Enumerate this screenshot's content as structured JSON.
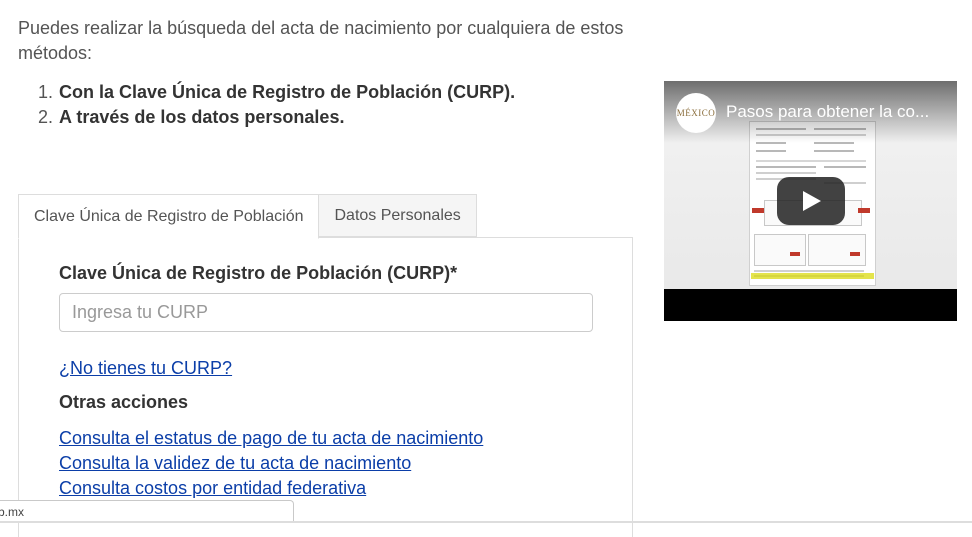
{
  "intro": {
    "text": "Puedes realizar la búsqueda del acta de nacimiento por cualquiera de estos métodos:"
  },
  "methods": [
    {
      "num": "1.",
      "text": "Con la Clave Única de Registro de Población (CURP)."
    },
    {
      "num": "2.",
      "text": "A través de los datos personales."
    }
  ],
  "tabs": [
    {
      "label": "Clave Única de Registro de Población",
      "active": true
    },
    {
      "label": "Datos Personales",
      "active": false
    }
  ],
  "form": {
    "curp_label": "Clave Única de Registro de Población (CURP)*",
    "curp_placeholder": "Ingresa tu CURP",
    "curp_value": "",
    "no_curp_link": "¿No tienes tu CURP?"
  },
  "other_actions": {
    "title": "Otras acciones",
    "links": [
      "Consulta el estatus de pago de tu acta de nacimiento",
      "Consulta la validez de tu acta de nacimiento",
      "Consulta costos por entidad federativa"
    ]
  },
  "video": {
    "channel_logo_text": "MÉXICO",
    "title": "Pasos para obtener la co...",
    "play_icon": "play-icon"
  },
  "status_bar": {
    "url": "b.mx"
  },
  "colors": {
    "link": "#0b3ea8",
    "text": "#545454",
    "heading": "#333333"
  }
}
